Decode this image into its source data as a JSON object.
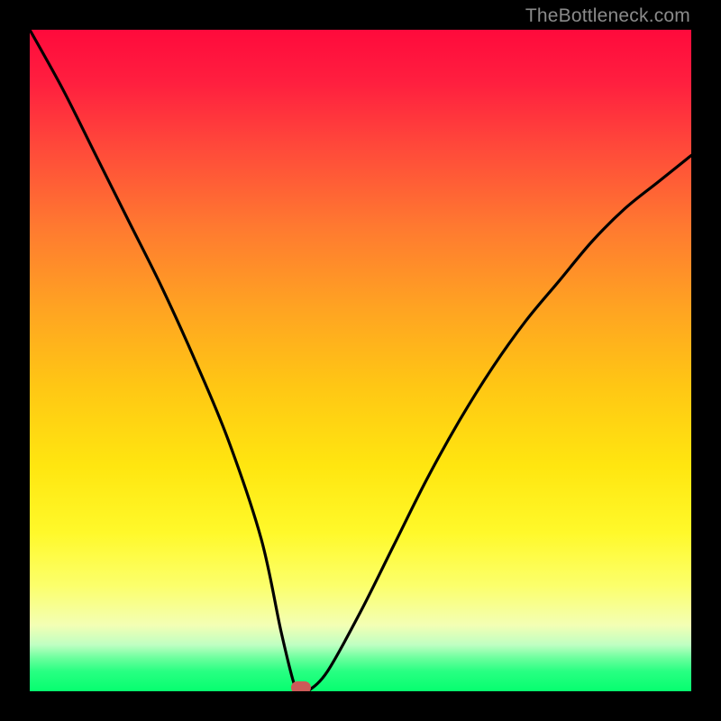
{
  "watermark": "TheBottleneck.com",
  "chart_data": {
    "type": "line",
    "title": "",
    "xlabel": "",
    "ylabel": "",
    "xlim": [
      0,
      100
    ],
    "ylim": [
      0,
      100
    ],
    "series": [
      {
        "name": "bottleneck-curve",
        "x": [
          0,
          5,
          10,
          15,
          20,
          25,
          30,
          35,
          38,
          40,
          41,
          42,
          45,
          50,
          55,
          60,
          65,
          70,
          75,
          80,
          85,
          90,
          95,
          100
        ],
        "y": [
          100,
          91,
          81,
          71,
          61,
          50,
          38,
          23,
          9,
          1,
          0,
          0,
          3,
          12,
          22,
          32,
          41,
          49,
          56,
          62,
          68,
          73,
          77,
          81
        ]
      }
    ],
    "marker": {
      "x": 41,
      "y": 0,
      "name": "optimal-point"
    },
    "gradient_stops": [
      {
        "pos": 0,
        "color": "#ff0a3c"
      },
      {
        "pos": 50,
        "color": "#ffc714"
      },
      {
        "pos": 85,
        "color": "#fcff6b"
      },
      {
        "pos": 100,
        "color": "#06fe6f"
      }
    ]
  }
}
